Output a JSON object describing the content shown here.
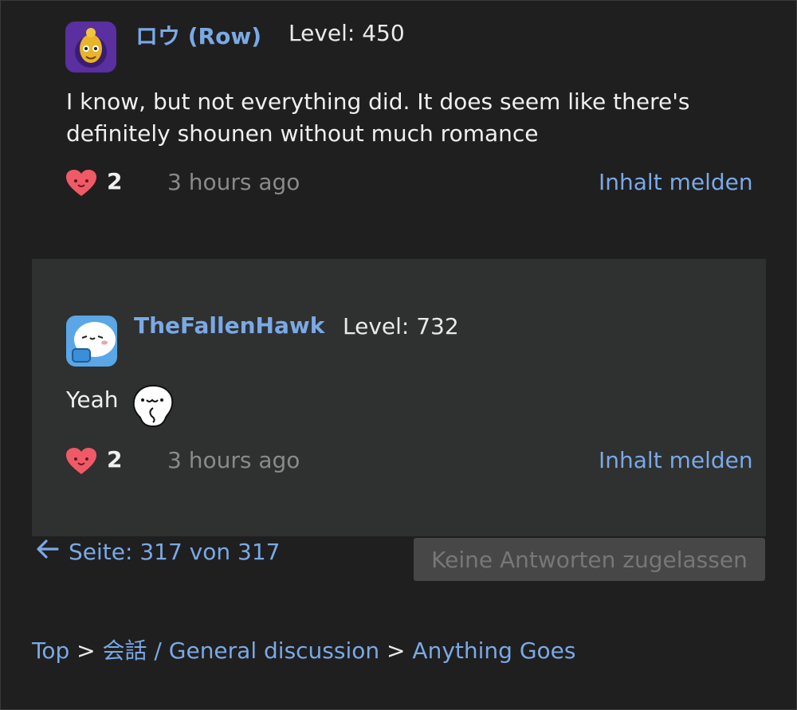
{
  "posts": [
    {
      "username": "ロウ (Row)",
      "level": "Level: 450",
      "body": "I know, but not everything did. It does seem like there's definitely shounen without much romance",
      "likes": "2",
      "time": "3 hours ago",
      "report_label": "Inhalt melden"
    },
    {
      "username": "TheFallenHawk",
      "level": "Level: 732",
      "body": "Yeah",
      "likes": "2",
      "time": "3 hours ago",
      "report_label": "Inhalt melden"
    }
  ],
  "pagination": {
    "label": "Seite: 317 von 317"
  },
  "reply_button": {
    "label": "Keine Antworten zugelassen"
  },
  "breadcrumb": {
    "items": [
      "Top",
      "会話 / General discussion",
      "Anything Goes"
    ],
    "separator": ">"
  },
  "colors": {
    "link": "#7aa9e6",
    "background": "#1f1f1f",
    "panel": "#2f3030",
    "heart": "#ef5a66"
  }
}
